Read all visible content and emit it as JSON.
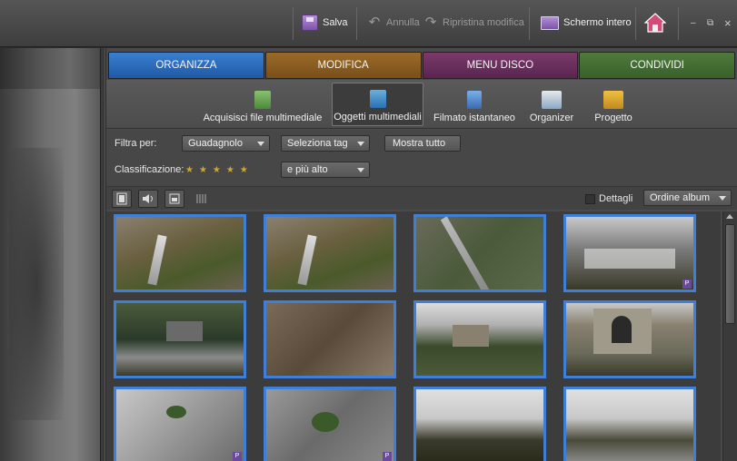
{
  "toolbar": {
    "save_label": "Salva",
    "undo_label": "Annulla",
    "redo_label": "Ripristina modifica",
    "fullscreen_label": "Schermo intero"
  },
  "window_controls": {
    "minimize": "–",
    "restore": "⧉",
    "close": "×"
  },
  "tabs": [
    {
      "label": "ORGANIZZA"
    },
    {
      "label": "MODIFICA"
    },
    {
      "label": "MENU DISCO"
    },
    {
      "label": "CONDIVIDI"
    }
  ],
  "subtoolbar": [
    {
      "label": "Acquisisci file multimediale",
      "icon": "import-icon"
    },
    {
      "label": "Oggetti multimediali",
      "icon": "media-icon"
    },
    {
      "label": "Filmato istantaneo",
      "icon": "film-icon"
    },
    {
      "label": "Organizer",
      "icon": "organizer-icon"
    },
    {
      "label": "Progetto",
      "icon": "project-icon"
    }
  ],
  "filters": {
    "filter_label": "Filtra per:",
    "filter_value": "Guadagnolo",
    "tag_value": "Seleziona tag",
    "show_all_label": "Mostra tutto",
    "rating_label": "Classificazione:",
    "rating_stars": "★★★★★",
    "rating_value": "e più alto"
  },
  "view": {
    "details_label": "Dettagli",
    "sort_value": "Ordine album"
  },
  "colors": {
    "accent": "#3f7fd8",
    "organizza": "#2a6cc0",
    "modifica": "#8a5d22",
    "menudisco": "#6a2f5d",
    "condividi": "#456e33"
  },
  "thumbnails": [
    {
      "badge": ""
    },
    {
      "badge": ""
    },
    {
      "badge": ""
    },
    {
      "badge": "P"
    },
    {
      "badge": ""
    },
    {
      "badge": ""
    },
    {
      "badge": ""
    },
    {
      "badge": ""
    },
    {
      "badge": "P"
    },
    {
      "badge": "P"
    },
    {
      "badge": ""
    },
    {
      "badge": ""
    }
  ]
}
